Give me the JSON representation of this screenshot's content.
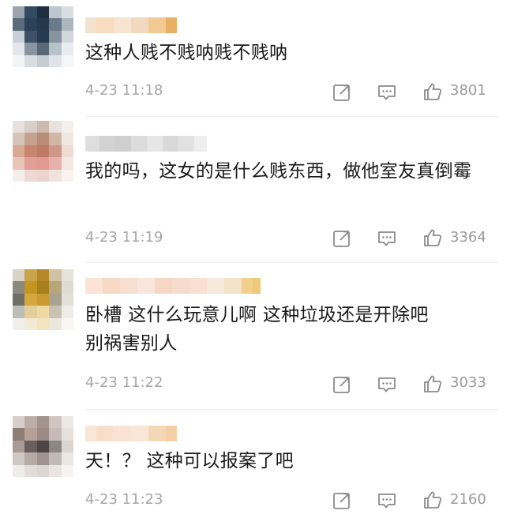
{
  "comments": [
    {
      "text": "这种人贱不贱呐贱不贱呐",
      "time": "4-23 11:18",
      "likes": "3801",
      "avatar_colors": [
        "#9ca3ab",
        "#324a62",
        "#1f2f40",
        "#bfc6cf",
        "#d8dde3",
        "#5b6b7c",
        "#2c4158",
        "#25384c",
        "#6b7a8a",
        "#aeb6bf",
        "#c8cfd6",
        "#3e5166",
        "#263a50",
        "#87939f",
        "#d1d6dc",
        "#e4e8ec",
        "#8894a0",
        "#5a6878",
        "#b9c1c9",
        "#e8ebef",
        "#f2f4f6",
        "#d7dce1",
        "#c5ccd3",
        "#e0e4e8",
        "#f5f6f8"
      ],
      "name_colors": [
        "#f3e2cf",
        "#f7dcbf",
        "#f7e4d0",
        "#f1d9c0",
        "#f0c994",
        "#e8b062"
      ]
    },
    {
      "text": "我的吗，这女的是什么贱东西，做他室友真倒霉",
      "time": "4-23 11:19",
      "likes": "3364",
      "avatar_colors": [
        "#e7e0dc",
        "#d9cfc9",
        "#cdb9ad",
        "#e8e1dd",
        "#f3efed",
        "#d6c4b8",
        "#c4a28e",
        "#b98d77",
        "#d2b7a7",
        "#efe7e2",
        "#d9a994",
        "#c7856d",
        "#bf7a65",
        "#cf9886",
        "#eddcd4",
        "#e8c4bb",
        "#df9f95",
        "#e09a92",
        "#e6b1aa",
        "#f4e6e2",
        "#f6eeeb",
        "#eed8d3",
        "#ecd3cd",
        "#f1e2de",
        "#f8f2f0"
      ],
      "name_colors": [
        "#dedede",
        "#d2d2d2",
        "#cfcfcf",
        "#dcdcdc",
        "#e6e6e6",
        "#d9d9d9",
        "#e1e1e1",
        "#eeeeee"
      ]
    },
    {
      "text": "卧槽 这什么玩意儿啊 这种垃圾还是开除吧\n别祸害别人",
      "time": "4-23 11:22",
      "likes": "3033",
      "avatar_colors": [
        "#d8d3c4",
        "#c9a44b",
        "#b8872a",
        "#cfc2a3",
        "#e7e3db",
        "#8a8a7d",
        "#c5961f",
        "#a7801d",
        "#b9a57a",
        "#dedbd3",
        "#6e7068",
        "#d4a73d",
        "#c99a2e",
        "#aaa290",
        "#e3e0d9",
        "#bdbdb8",
        "#e3cf9a",
        "#edd9a1",
        "#c9c3b4",
        "#eeece8",
        "#efefec",
        "#f2ead2",
        "#f3e4bf",
        "#ebe7dd",
        "#f7f6f4"
      ],
      "name_colors": [
        "#fbe3d6",
        "#f8d9c6",
        "#f6dfcf",
        "#fae6da",
        "#f7d7c4",
        "#f5dccb",
        "#fae0d2",
        "#f8e9dd",
        "#f1e2c8",
        "#f2d08c",
        "#f0c878"
      ]
    },
    {
      "text": "天！？ 这种可以报案了吧",
      "time": "4-23 11:23",
      "likes": "2160",
      "avatar_colors": [
        "#d7cfcb",
        "#bcaea7",
        "#a2938d",
        "#cfc6c2",
        "#ece8e6",
        "#8e7d77",
        "#b5a198",
        "#9b8b84",
        "#c7bbb5",
        "#e6e0dd",
        "#a89a94",
        "#6a5e5c",
        "#4d4446",
        "#8f8582",
        "#dcd5d2",
        "#cfc7c4",
        "#b5aaa6",
        "#9f9491",
        "#c3bab6",
        "#ebe7e5",
        "#efecea",
        "#e2dcda",
        "#ddd6d3",
        "#e9e5e3",
        "#f6f4f3"
      ],
      "name_colors": [
        "#fbe6d6",
        "#f9dfca",
        "#fae3d3",
        "#f8e6d8",
        "#f4d8b6",
        "#f3cfa3"
      ]
    }
  ],
  "icons": {
    "share": "share-icon",
    "comment": "comment-icon",
    "like": "thumbs-up-icon"
  }
}
